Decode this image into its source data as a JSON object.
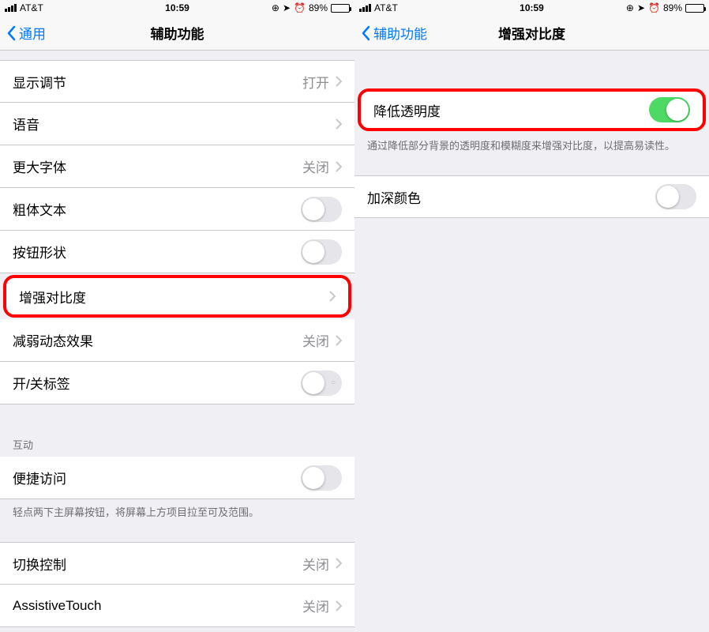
{
  "status": {
    "carrier": "AT&T",
    "time": "10:59",
    "battery_pct": "89%"
  },
  "left": {
    "back_label": "通用",
    "title": "辅助功能",
    "rows": {
      "display": {
        "label": "显示调节",
        "value": "打开"
      },
      "voice": {
        "label": "语音"
      },
      "larger_text": {
        "label": "更大字体",
        "value": "关闭"
      },
      "bold_text": {
        "label": "粗体文本"
      },
      "button_shapes": {
        "label": "按钮形状"
      },
      "increase_contrast": {
        "label": "增强对比度"
      },
      "reduce_motion": {
        "label": "减弱动态效果",
        "value": "关闭"
      },
      "onoff_labels": {
        "label": "开/关标签"
      }
    },
    "interaction_header": "互动",
    "reachability": {
      "label": "便捷访问"
    },
    "reachability_footer": "轻点两下主屏幕按钮，将屏幕上方项目拉至可及范围。",
    "switch_control": {
      "label": "切换控制",
      "value": "关闭"
    },
    "assistive_touch": {
      "label": "AssistiveTouch",
      "value": "关闭"
    }
  },
  "right": {
    "back_label": "辅助功能",
    "title": "增强对比度",
    "reduce_transparency": {
      "label": "降低透明度"
    },
    "reduce_transparency_footer": "通过降低部分背景的透明度和模糊度来增强对比度，以提高易读性。",
    "darken_colors": {
      "label": "加深颜色"
    }
  }
}
